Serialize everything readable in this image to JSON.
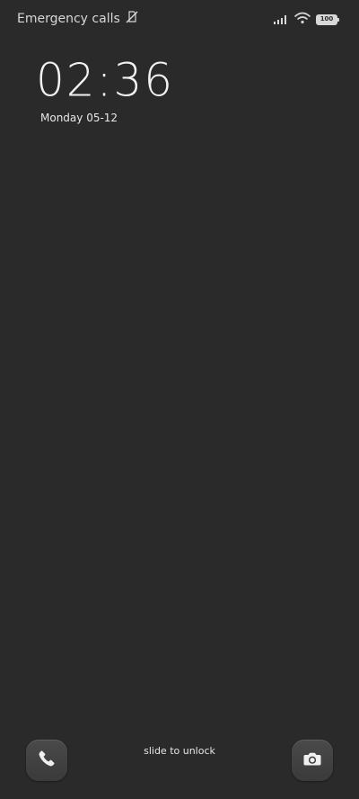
{
  "status_bar": {
    "left_text": "Emergency calls",
    "icons": [
      "no-sim-icon",
      "signal-icon",
      "wifi-icon",
      "battery-icon"
    ],
    "battery_level": "100"
  },
  "lock_screen": {
    "time": "02:36",
    "date": "Monday 05-12",
    "unlock_hint": "slide to unlock"
  },
  "shortcuts": {
    "left": "phone-icon",
    "right": "camera-icon"
  },
  "colors": {
    "background": "#2a2a2a",
    "text": "#ffffff",
    "muted_text": "#d8d8d8",
    "button_bg": "#444444"
  }
}
